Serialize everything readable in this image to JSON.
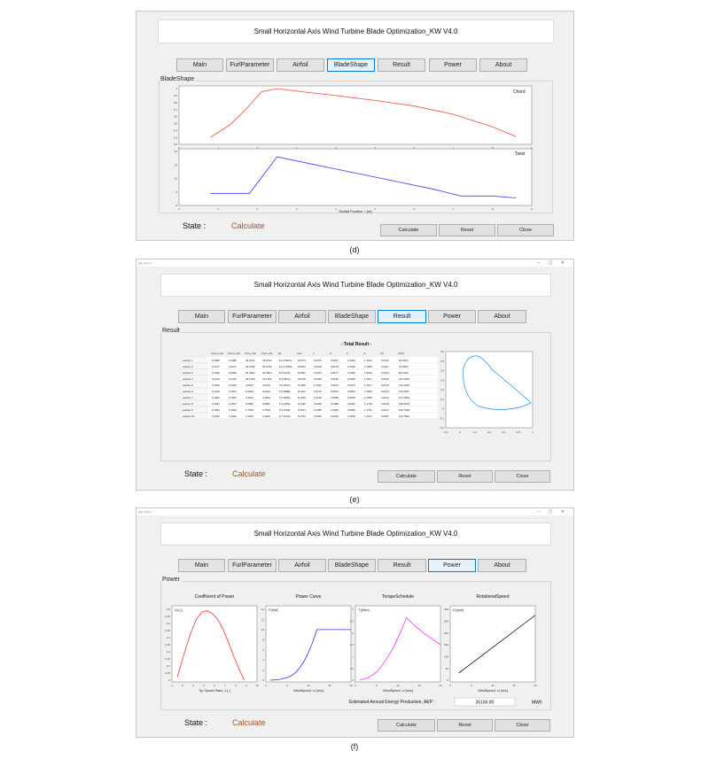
{
  "app_title": "Small Horizontal Axis Wind Turbine Blade Optimization_KW V4.0",
  "window_caption": "bak_0r12_1",
  "window_controls": "–  ▢  ✕",
  "tabs": [
    "Main",
    "FurlParameter",
    "Airfoil",
    "BladeShape",
    "Result",
    "Power",
    "About"
  ],
  "state_label": "State :",
  "state_value": "Calculate",
  "buttons": {
    "calculate": "Calculate",
    "reset": "Reset",
    "close": "Close"
  },
  "panels": {
    "bladeshape": "BladeShape",
    "result": "Result",
    "power": "Power"
  },
  "captions": [
    "(d)",
    "(e)",
    "(f)"
  ],
  "colors": {
    "active_tab": "#e5f1fb",
    "active_tab_border": "#0078d7",
    "state_value": "#a0522d",
    "chord_line": "#ff4444",
    "twist_line": "#3b3bff"
  },
  "bladeshape": {
    "chord_label": "Chord",
    "twist_label": "Twist",
    "xlabel": "Radial Position, r [m]",
    "x_ticks": [
      "0",
      "1",
      "2",
      "3",
      "4",
      "5",
      "6",
      "7",
      "8",
      "9"
    ],
    "chord_y_ticks": [
      "0.2",
      "0.3",
      "0.4",
      "0.5",
      "0.6",
      "0.7",
      "0.8",
      "0.9",
      "1"
    ],
    "twist_y_ticks": [
      "0",
      "5",
      "10",
      "15",
      "20"
    ]
  },
  "result": {
    "total_title": "- Total Result -",
    "columns": [
      "Chord_calc",
      "Chord_edit",
      "Twist_calc",
      "Twist_edit",
      "Re",
      "AoA",
      "a",
      "a'",
      "F",
      "Cl",
      "Cd",
      "Cl/Cd"
    ],
    "rows": [
      [
        "section 1",
        "0.2980",
        "0.2980",
        "49.0132",
        "49.0132",
        "10.2.0997e",
        "8.0273",
        "0.0070",
        "0.8027",
        "1.0000",
        "1.4022",
        "0.0212",
        "66.6430"
      ],
      [
        "section 2",
        "0.3217",
        "0.3217",
        "40.1059",
        "40.1059",
        "10.2.4408e",
        "8.0252",
        "0.0108",
        "0.8178",
        "1.0000",
        "1.4895",
        "0.0201",
        "74.2683"
      ],
      [
        "section 3",
        "0.3490",
        "0.3490",
        "25.4952",
        "25.4952",
        "8.3.1074e",
        "8.0587",
        "0.0257",
        "0.8177",
        "1.0000",
        "1.5620",
        "0.0154",
        "84.2196"
      ],
      [
        "section 4",
        "0.2410",
        "0.2410",
        "18.1259",
        "18.1259",
        "8.4.0037e",
        "8.0748",
        "0.0292",
        "0.8132",
        "0.9999",
        "1.2817",
        "0.0136",
        "102.6652"
      ],
      [
        "section 5",
        "0.1920",
        "0.1920",
        "3.0015",
        "3.0015",
        "6.5.2547e",
        "8.1056",
        "0.1251",
        "0.8100",
        "0.9972",
        "1.4977",
        "0.0123",
        "112.3326"
      ],
      [
        "section 6",
        "0.1510",
        "0.1510",
        "2.9409",
        "2.9409",
        "6.5.3988e",
        "8.1202",
        "0.2178",
        "0.8100",
        "0.9953",
        "1.4580",
        "0.0123",
        "113.2967"
      ],
      [
        "section 7",
        "0.1662",
        "0.1662",
        "4.3632",
        "4.3632",
        "6.5.0535e",
        "8.1339",
        "0.2128",
        "0.0096",
        "0.9925",
        "1.1955",
        "0.0112",
        "107.2963"
      ],
      [
        "section 8",
        "0.1597",
        "0.1597",
        "3.0582",
        "3.0582",
        "6.5.2399e",
        "8.1426",
        "0.2293",
        "0.0088",
        "0.9293",
        "1.1734",
        "0.0109",
        "108.5042"
      ],
      [
        "section 9",
        "0.1506",
        "0.1506",
        "2.7818",
        "2.7818",
        "6.5.0133e",
        "8.1514",
        "0.2388",
        "0.0084",
        "0.8835",
        "1.1791",
        "0.0107",
        "109.7900"
      ],
      [
        "section 10",
        "0.1394",
        "0.1394",
        "2.3046",
        "2.3046",
        "8.7.0743e",
        "8.1751",
        "0.3520",
        "0.0224",
        "0.3525",
        "1.1143",
        "0.0097",
        "114.7560"
      ]
    ],
    "airfoil_x_ticks": [
      "0.2",
      "0",
      "0.2",
      "0.4",
      "0.6",
      "0.8",
      "1"
    ],
    "airfoil_y_ticks": [
      "0.6",
      "0.5",
      "0.4",
      "0.3",
      "0.2",
      "0.1",
      "0",
      "-0.1",
      "-0.2"
    ]
  },
  "power": {
    "cop": {
      "title": "Coefficient of Power",
      "ylabel": "Cp [-]",
      "xlabel": "Tip Speed Ratio, λ [-]",
      "x_ticks": [
        "2",
        "3",
        "4",
        "5",
        "6",
        "7",
        "8",
        "9",
        "10"
      ],
      "y_ticks": [
        "0.5",
        "0.45",
        "0.4",
        "0.35",
        "0.3",
        "0.25",
        "0.2",
        "0.15",
        "0.1",
        "0.05",
        "0"
      ]
    },
    "curve": {
      "title": "Power Curve",
      "ylabel": "P [kW]",
      "xlabel": "WindSpeed, U [m/s]",
      "x_ticks": [
        "0",
        "5",
        "10",
        "15",
        "20"
      ],
      "y_ticks": [
        "14",
        "12",
        "10",
        "8",
        "6",
        "4",
        "2",
        "0"
      ]
    },
    "torque": {
      "title": "TorqueSchedule",
      "ylabel": "T [kNm]",
      "xlabel": "WindSpeed, U [m/s]",
      "x_ticks": [
        "0",
        "5",
        "10",
        "15",
        "20"
      ],
      "y_ticks": [
        "3",
        "2.5",
        "2",
        "1.5",
        "1",
        "0.5",
        "0"
      ]
    },
    "rot": {
      "title": "RotationalSpeed",
      "ylabel": "Ω [rpm]",
      "xlabel": "WindSpeed, U [m/s]",
      "x_ticks": [
        "0",
        "5",
        "10",
        "15",
        "20"
      ],
      "y_ticks": [
        "300",
        "250",
        "200",
        "150",
        "100",
        "50",
        "0"
      ]
    },
    "aep_label": "Estimated Annual Energy Production, AEP :",
    "aep_value": "35166.80",
    "aep_unit": "MWh"
  },
  "chart_data": [
    {
      "type": "line",
      "name": "Chord",
      "x": [
        0.8,
        1.3,
        1.7,
        2.1,
        2.5,
        3.2,
        4.0,
        5.0,
        6.0,
        7.0,
        8.0,
        8.6
      ],
      "values": [
        0.3,
        0.48,
        0.7,
        0.95,
        1.0,
        0.95,
        0.9,
        0.83,
        0.75,
        0.63,
        0.45,
        0.31
      ],
      "xlabel": "Radial Position, r [m]",
      "xlim": [
        0,
        9
      ],
      "ylim": [
        0.2,
        1.0
      ]
    },
    {
      "type": "line",
      "name": "Twist",
      "x": [
        0.8,
        1.8,
        2.5,
        3.5,
        4.5,
        5.5,
        6.5,
        7.2,
        8.0,
        8.6
      ],
      "values": [
        4.5,
        4.5,
        18,
        15,
        12,
        9,
        6,
        3.5,
        3.5,
        2.8
      ],
      "xlabel": "Radial Position, r [m]",
      "xlim": [
        0,
        9
      ],
      "ylim": [
        0,
        20
      ]
    },
    {
      "type": "line",
      "name": "Cp",
      "x": [
        2.5,
        3.2,
        3.8,
        4.3,
        4.8,
        5.3,
        5.8,
        6.3,
        6.8,
        7.3,
        7.8,
        8.3,
        8.8
      ],
      "values": [
        0.02,
        0.2,
        0.34,
        0.43,
        0.48,
        0.49,
        0.47,
        0.43,
        0.36,
        0.27,
        0.17,
        0.08,
        0.0
      ],
      "xlabel": "Tip Speed Ratio, λ [-]",
      "ylabel": "Cp [-]",
      "xlim": [
        2,
        10
      ],
      "ylim": [
        0,
        0.5
      ]
    },
    {
      "type": "line",
      "name": "Power",
      "x": [
        1,
        3,
        5,
        6,
        7,
        8,
        9,
        10,
        11,
        12,
        15,
        20
      ],
      "values": [
        0,
        0.1,
        0.5,
        0.9,
        1.5,
        2.5,
        3.8,
        5.5,
        7.5,
        10,
        10,
        10
      ],
      "xlabel": "WindSpeed, U [m/s]",
      "ylabel": "P [kW]",
      "xlim": [
        0,
        20
      ],
      "ylim": [
        0,
        14
      ]
    },
    {
      "type": "line",
      "name": "Torque",
      "x": [
        1,
        3,
        5,
        7,
        9,
        11,
        12,
        14,
        16,
        18,
        20
      ],
      "values": [
        0,
        0.1,
        0.35,
        0.8,
        1.4,
        2.2,
        2.65,
        2.3,
        2.0,
        1.75,
        1.5
      ],
      "xlabel": "WindSpeed, U [m/s]",
      "ylabel": "T [kNm]",
      "xlim": [
        0,
        20
      ],
      "ylim": [
        0,
        3
      ]
    },
    {
      "type": "line",
      "name": "RotationalSpeed",
      "x": [
        2,
        20
      ],
      "values": [
        30,
        275
      ],
      "xlabel": "WindSpeed, U [m/s]",
      "ylabel": "Ω [rpm]",
      "xlim": [
        0,
        20
      ],
      "ylim": [
        0,
        300
      ]
    }
  ]
}
